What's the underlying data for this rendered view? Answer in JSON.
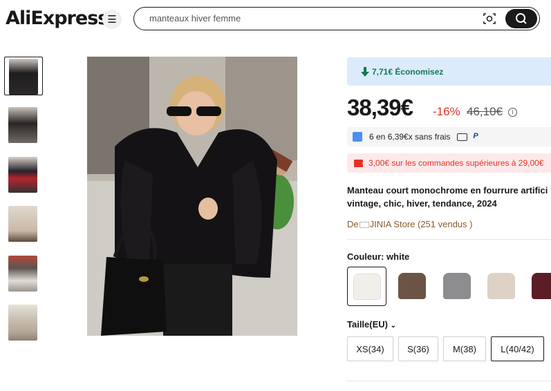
{
  "header": {
    "logo": "AliExpress",
    "search_placeholder": "manteaux hiver femme",
    "icons": [
      "menu-icon",
      "camera-search-icon",
      "search-icon"
    ]
  },
  "gallery": {
    "thumbnail_count": 6,
    "selected_index": 0
  },
  "product": {
    "savings": "7,71€ Économisez",
    "price": "38,39€",
    "discount": "-16%",
    "original_price": "46,10€",
    "installments": "6 en 6,39€x sans frais",
    "coupon": "3,00€ sur les commandes supérieures à 29,00€",
    "title_line1": "Manteau court monochrome en fourrure artifici",
    "title_line2": "vintage, chic, hiver, tendance, 2024",
    "store_prefix": "De",
    "store_name": "JINIA Store (251 vendus )"
  },
  "color": {
    "label": "Couleur: white",
    "options": [
      "white",
      "brown",
      "grey",
      "beige",
      "wine"
    ],
    "hex": [
      "#f2efea",
      "#6b5445",
      "#8d8c8e",
      "#ddd2c5",
      "#5b1e27"
    ]
  },
  "size": {
    "label": "Taille(EU)",
    "options": [
      "XS(34)",
      "S(36)",
      "M(38)",
      "L(40/42)"
    ],
    "selected": "L(40/42)"
  },
  "colors": {
    "accent_red": "#e43225",
    "save_green": "#0f7a55",
    "save_bg": "#dcebfb"
  }
}
